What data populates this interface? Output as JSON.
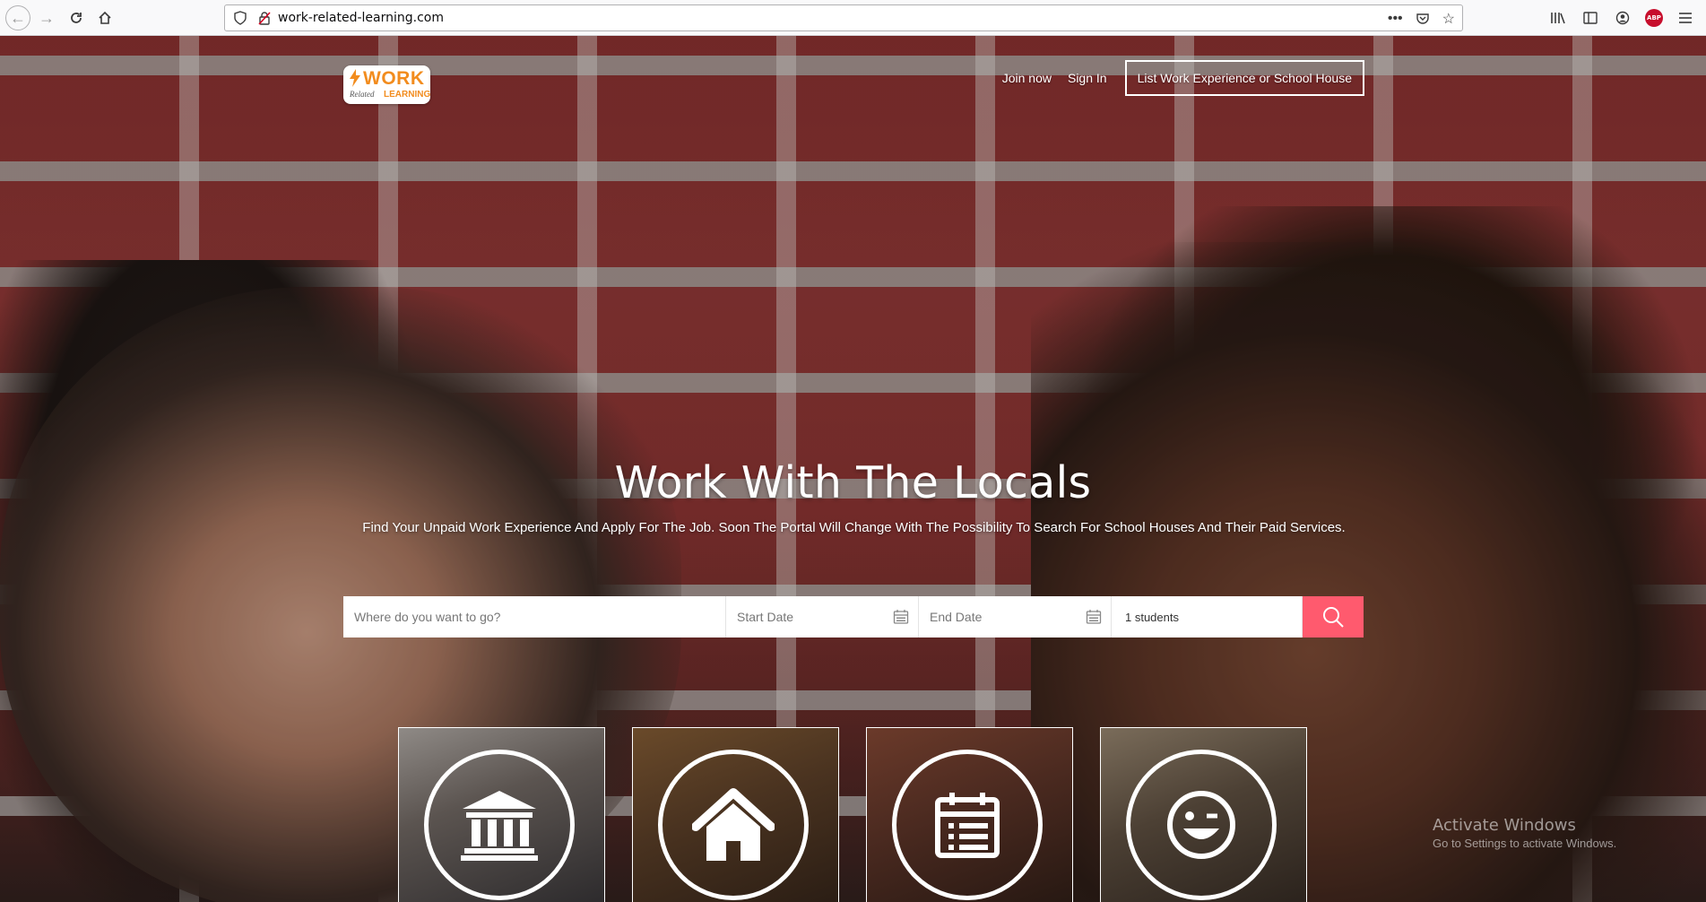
{
  "browser": {
    "url": "work-related-learning.com",
    "abp_label": "ABP"
  },
  "logo": {
    "work": "WORK",
    "related": "Related",
    "learning": "LEARNING"
  },
  "nav": {
    "join": "Join now",
    "signin": "Sign In",
    "list_button": "List Work Experience or School House"
  },
  "hero": {
    "title": "Work With The Locals",
    "subtitle": "Find Your Unpaid Work Experience And Apply For The Job. Soon The Portal Will Change With The Possibility To Search For School Houses And Their Paid Services."
  },
  "search": {
    "where_placeholder": "Where do you want to go?",
    "start_placeholder": "Start Date",
    "end_placeholder": "End Date",
    "students_value": "1 students"
  },
  "cards": [
    {
      "icon": "bank-icon"
    },
    {
      "icon": "house-icon"
    },
    {
      "icon": "calendar-list-icon"
    },
    {
      "icon": "wink-face-icon"
    }
  ],
  "watermark": {
    "title": "Activate Windows",
    "subtitle": "Go to Settings to activate Windows."
  },
  "colors": {
    "accent": "#ff5a6e",
    "logo_orange": "#f28c1e"
  }
}
